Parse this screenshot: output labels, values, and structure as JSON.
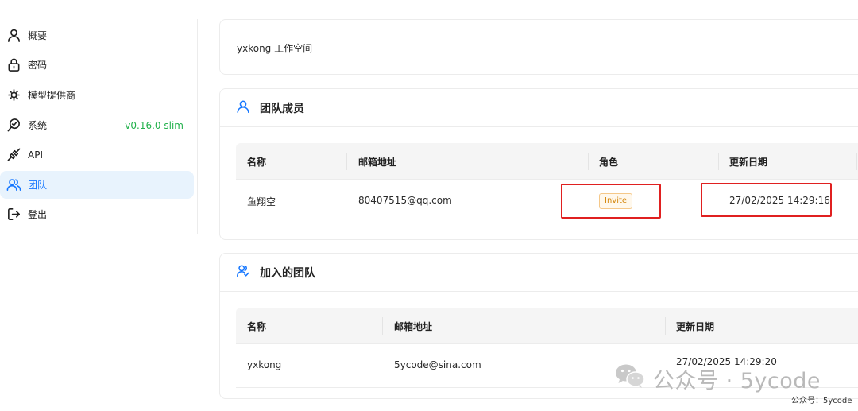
{
  "sidebar": {
    "items": [
      {
        "label": "概要",
        "icon": "user-icon"
      },
      {
        "label": "密码",
        "icon": "lock-icon"
      },
      {
        "label": "模型提供商",
        "icon": "model-provider-icon"
      },
      {
        "label": "系统",
        "icon": "system-icon"
      },
      {
        "label": "API",
        "icon": "api-plug-icon"
      },
      {
        "label": "团队",
        "icon": "team-icon",
        "active": true
      },
      {
        "label": "登出",
        "icon": "logout-icon"
      }
    ],
    "version": "v0.16.0 slim"
  },
  "workspace": {
    "title": "yxkong 工作空间"
  },
  "members": {
    "title": "团队成员",
    "icon": "user-outline-icon",
    "columns": [
      "名称",
      "邮箱地址",
      "角色",
      "更新日期"
    ],
    "rows": [
      {
        "name": "鱼翔空",
        "email": "80407515@qq.com",
        "role": "Invite",
        "updated": "27/02/2025 14:29:16"
      }
    ]
  },
  "joined": {
    "title": "加入的团队",
    "icon": "users-outline-icon",
    "columns": [
      "名称",
      "邮箱地址",
      "更新日期"
    ],
    "rows": [
      {
        "name": "yxkong",
        "email": "5ycode@sina.com",
        "updated": "27/02/2025 14:29:20"
      }
    ]
  },
  "watermark": {
    "text": "公众号 · 5ycode",
    "small": "公众号：5ycode",
    "icon": "wechat-icon"
  },
  "colors": {
    "accent": "#1677ff",
    "version": "#22b14c",
    "highlight": "#e02020",
    "badge": "#d4860b"
  }
}
